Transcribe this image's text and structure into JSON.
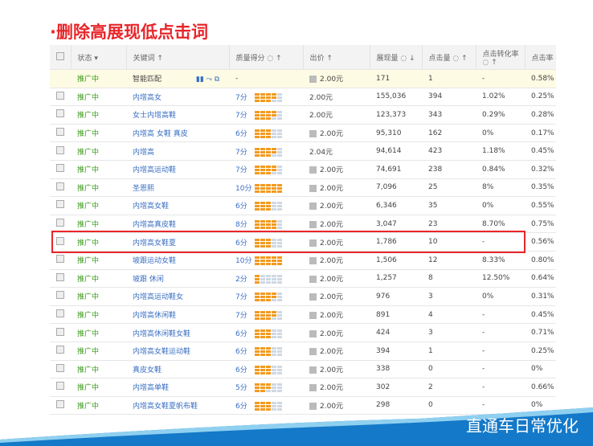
{
  "title": "·删除高展现低点击词",
  "headers": {
    "status": "状态 ▾",
    "keyword": "关键词 ↑",
    "quality": "质量得分 ◌ ↑",
    "bid": "出价 ↑",
    "impressions": "展现量 ◌ ↓",
    "clicks": "点击量 ◌ ↑",
    "conversion": "点击转化率 ◌ ↑",
    "ctr": "点击率 ◌"
  },
  "smart_row": {
    "status": "推广中",
    "keyword": "智能匹配",
    "quality": "-",
    "bid": "2.00元",
    "impressions": "171",
    "clicks": "1",
    "conversion": "-",
    "ctr": "0.58%"
  },
  "rows": [
    {
      "status": "推广中",
      "keyword": "内增高女",
      "score": 7,
      "quality": "7分",
      "bid": "2.00元",
      "icon": false,
      "impressions": "155,036",
      "clicks": "394",
      "conversion": "1.02%",
      "ctr": "0.25%"
    },
    {
      "status": "推广中",
      "keyword": "女士内增高鞋",
      "score": 7,
      "quality": "7分",
      "bid": "2.00元",
      "icon": false,
      "impressions": "123,373",
      "clicks": "343",
      "conversion": "0.29%",
      "ctr": "0.28%"
    },
    {
      "status": "推广中",
      "keyword": "内增高 女鞋 真皮",
      "score": 6,
      "quality": "6分",
      "bid": "2.00元",
      "icon": true,
      "impressions": "95,310",
      "clicks": "162",
      "conversion": "0%",
      "ctr": "0.17%"
    },
    {
      "status": "推广中",
      "keyword": "内增高",
      "score": 7,
      "quality": "7分",
      "bid": "2.04元",
      "icon": false,
      "impressions": "94,614",
      "clicks": "423",
      "conversion": "1.18%",
      "ctr": "0.45%"
    },
    {
      "status": "推广中",
      "keyword": "内增高运动鞋",
      "score": 7,
      "quality": "7分",
      "bid": "2.00元",
      "icon": true,
      "impressions": "74,691",
      "clicks": "238",
      "conversion": "0.84%",
      "ctr": "0.32%"
    },
    {
      "status": "推广中",
      "keyword": "圣恩熙",
      "score": 10,
      "quality": "10分",
      "bid": "2.00元",
      "icon": true,
      "impressions": "7,096",
      "clicks": "25",
      "conversion": "8%",
      "ctr": "0.35%"
    },
    {
      "status": "推广中",
      "keyword": "内增高女鞋",
      "score": 6,
      "quality": "6分",
      "bid": "2.00元",
      "icon": true,
      "impressions": "6,346",
      "clicks": "35",
      "conversion": "0%",
      "ctr": "0.55%"
    },
    {
      "status": "推广中",
      "keyword": "内增高真皮鞋",
      "score": 8,
      "quality": "8分",
      "bid": "2.00元",
      "icon": true,
      "impressions": "3,047",
      "clicks": "23",
      "conversion": "8.70%",
      "ctr": "0.75%"
    },
    {
      "status": "推广中",
      "keyword": "内增高女鞋夏",
      "score": 6,
      "quality": "6分",
      "bid": "2.00元",
      "icon": true,
      "impressions": "1,786",
      "clicks": "10",
      "conversion": "-",
      "ctr": "0.56%"
    },
    {
      "status": "推广中",
      "keyword": "坡跟运动女鞋",
      "score": 10,
      "quality": "10分",
      "bid": "2.00元",
      "icon": true,
      "impressions": "1,506",
      "clicks": "12",
      "conversion": "8.33%",
      "ctr": "0.80%"
    },
    {
      "status": "推广中",
      "keyword": "坡跟 休闲",
      "score": 2,
      "quality": "2分",
      "bid": "2.00元",
      "icon": true,
      "impressions": "1,257",
      "clicks": "8",
      "conversion": "12.50%",
      "ctr": "0.64%"
    },
    {
      "status": "推广中",
      "keyword": "内增高运动鞋女",
      "score": 7,
      "quality": "7分",
      "bid": "2.00元",
      "icon": true,
      "impressions": "976",
      "clicks": "3",
      "conversion": "0%",
      "ctr": "0.31%"
    },
    {
      "status": "推广中",
      "keyword": "内增高休闲鞋",
      "score": 7,
      "quality": "7分",
      "bid": "2.00元",
      "icon": true,
      "impressions": "891",
      "clicks": "4",
      "conversion": "-",
      "ctr": "0.45%"
    },
    {
      "status": "推广中",
      "keyword": "内增高休闲鞋女鞋",
      "score": 6,
      "quality": "6分",
      "bid": "2.00元",
      "icon": true,
      "impressions": "424",
      "clicks": "3",
      "conversion": "-",
      "ctr": "0.71%"
    },
    {
      "status": "推广中",
      "keyword": "内增高女鞋运动鞋",
      "score": 6,
      "quality": "6分",
      "bid": "2.00元",
      "icon": true,
      "impressions": "394",
      "clicks": "1",
      "conversion": "-",
      "ctr": "0.25%"
    },
    {
      "status": "推广中",
      "keyword": "真皮女鞋",
      "score": 6,
      "quality": "6分",
      "bid": "2.00元",
      "icon": true,
      "impressions": "338",
      "clicks": "0",
      "conversion": "-",
      "ctr": "0%"
    },
    {
      "status": "推广中",
      "keyword": "内增高单鞋",
      "score": 5,
      "quality": "5分",
      "bid": "2.00元",
      "icon": true,
      "impressions": "302",
      "clicks": "2",
      "conversion": "-",
      "ctr": "0.66%"
    },
    {
      "status": "推广中",
      "keyword": "内增高女鞋夏帆布鞋",
      "score": 6,
      "quality": "6分",
      "bid": "2.00元",
      "icon": true,
      "impressions": "298",
      "clicks": "0",
      "conversion": "-",
      "ctr": "0%"
    }
  ],
  "footer": "直通车日常优化",
  "colors": {
    "accent": "#e8262a",
    "status": "#3a9a1a",
    "link": "#3a6fc2",
    "bar": "#f39a1e"
  }
}
